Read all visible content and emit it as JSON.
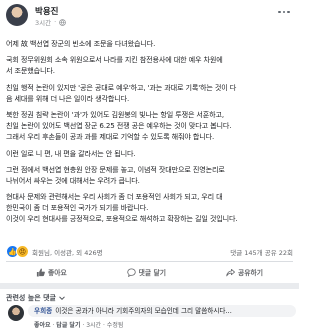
{
  "post": {
    "author": "박용진",
    "time": "3시간",
    "paragraphs": [
      [
        "어제 故 백선엽 장군의 빈소에 조문을 다녀왔습니다."
      ],
      [
        "국회 정무위원회 소속 위원으로서 나라를 지킨 참전용사에 대한 예우 차원에",
        "서 조문했습니다."
      ],
      [
        "친일 행적 논란이 있지만 '공은 공대로 예우'하고, '과는 과대로 기록'하는 것이 다",
        "음 세대를 위해 더 나은 일이라 생각합니다."
      ],
      [
        "북한 정권 침략 논란이 '과'가 있어도 김원봉의 빛나는 항일 투쟁은 서훈하고,",
        "친일 논란이 있어도 백선엽 장군 6.25 전쟁 공은 예우하는 것이 맞다고 봅니다.",
        "그래서 우리 후손들이 공과 과를 제대로 기억할 수 있도록 해줘야 합니다."
      ],
      [
        "이런 일로 니 편, 내 편을 갈라서는 안 됩니다."
      ],
      [
        "그런 점에서 백선엽 현충원 안장 문제를 놓고, 이념적 잣대만으로 진영논리로",
        "나뉘어서 싸우는 것에 대해서는 우려가 큽니다."
      ],
      [
        "현대사 문제와 관련해서는 우리 사회가 좀 더 포용적인 사회가 되고, 우리 대",
        "한민국이 좀 더 포용적인 국가가 되기를 바랍니다.",
        "이것이 우리 현대사를 긍정적으로, 포용적으로 해석하고 확장하는 길일 것입니다."
      ]
    ]
  },
  "reactions": {
    "names": "회원님, 이성관, 외 426명",
    "counts": "댓글 145개  공유 22회"
  },
  "actions": [
    "좋아요",
    "댓글 달기",
    "공유하기"
  ],
  "related": {
    "title": "관련성 높은 댓글",
    "comment_author": "우희종",
    "comment_text": "이것은 공과가 아니라 기회주의자의 모습인데 그리 말씀하시다...",
    "comment_meta": [
      "좋아요",
      "답글 달기",
      "3시간",
      "수정됨"
    ]
  },
  "icons": {
    "globe": "globe-icon",
    "more": "more-options-icon",
    "like": "thumbs-up-icon",
    "comment": "comment-icon",
    "share": "share-icon"
  },
  "colors": {
    "link": "#385898",
    "like": "#1877f2",
    "muted": "#65676b"
  }
}
